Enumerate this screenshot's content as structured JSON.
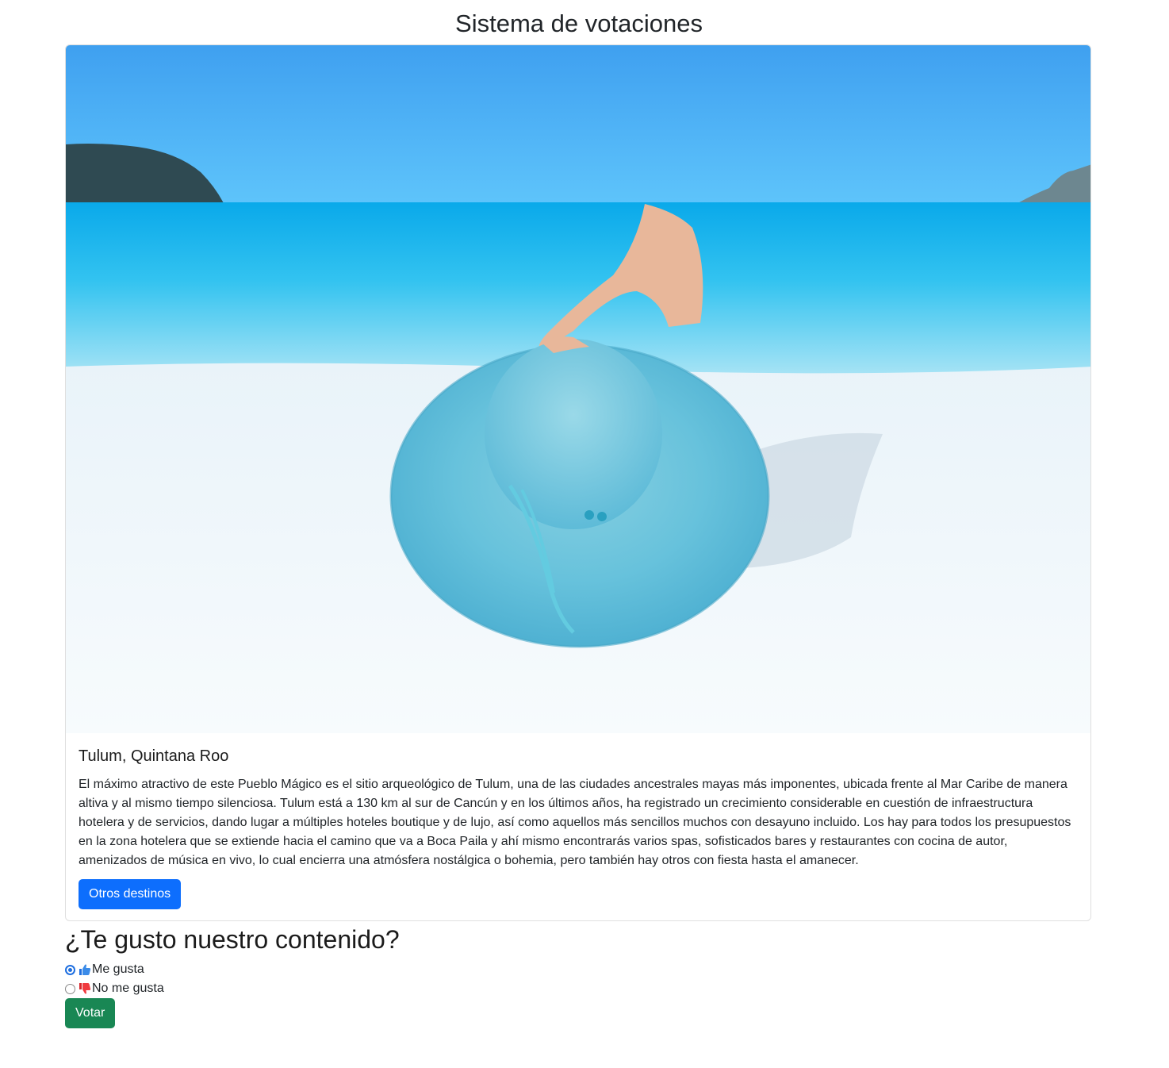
{
  "page": {
    "title": "Sistema de votaciones"
  },
  "card": {
    "image_alt": "Playa con sombrero azul",
    "title": "Tulum, Quintana Roo",
    "text": "El máximo atractivo de este Pueblo Mágico es el sitio arqueológico de Tulum, una de las ciudades ancestrales mayas más imponentes, ubicada frente al Mar Caribe de manera altiva y al mismo tiempo silenciosa. Tulum está a 130 km al sur de Cancún y en los últimos años, ha registrado un crecimiento considerable en cuestión de infraestructura hotelera y de servicios, dando lugar a múltiples hoteles boutique y de lujo, así como aquellos más sencillos muchos con desayuno incluido. Los hay para todos los presupuestos en la zona hotelera que se extiende hacia el camino que va a Boca Paila y ahí mismo encontrarás varios spas, sofisticados bares y restaurantes con cocina de autor, amenizados de música en vivo, lo cual encierra una atmósfera nostálgica o bohemia, pero también hay otros con fiesta hasta el amanecer.",
    "button_label": "Otros destinos"
  },
  "vote": {
    "question": "¿Te gusto nuestro contenido?",
    "options": [
      {
        "label": "Me gusta",
        "icon": "thumbs-up-icon",
        "checked": true
      },
      {
        "label": "No me gusta",
        "icon": "thumbs-down-icon",
        "checked": false
      }
    ],
    "submit_label": "Votar"
  },
  "colors": {
    "primary": "#0d6efd",
    "success": "#198754",
    "radio_checked": "#1f6fe0"
  }
}
